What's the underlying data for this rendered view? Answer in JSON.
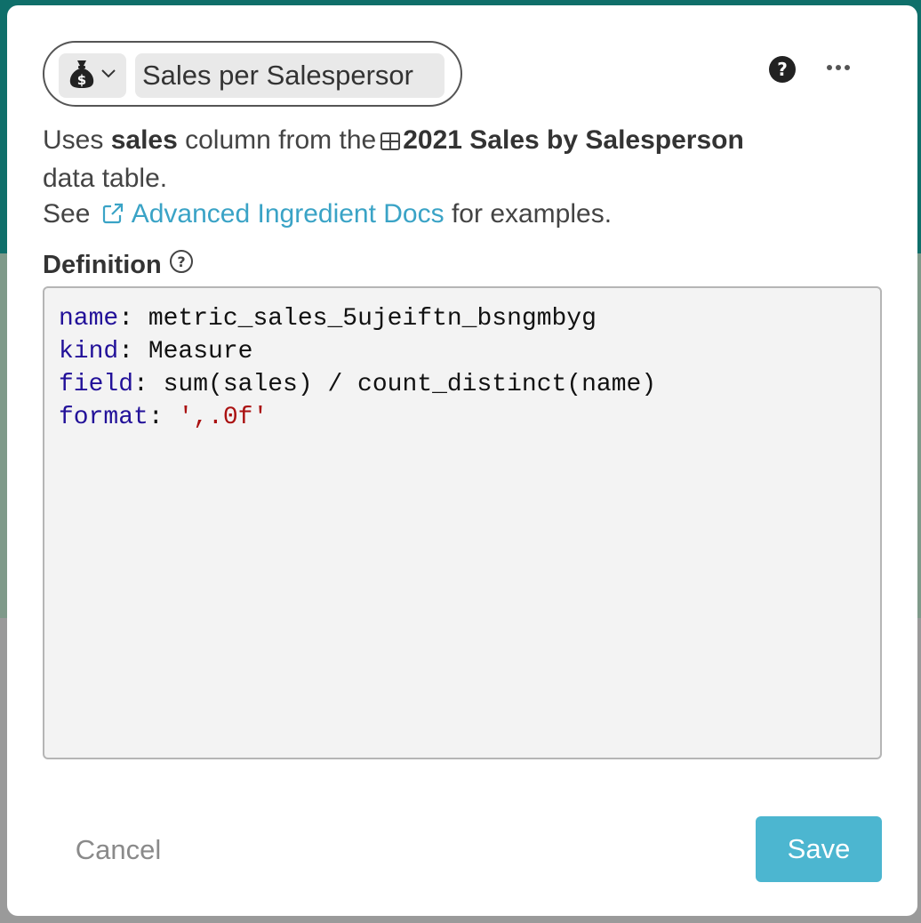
{
  "header": {
    "icon": "money-bag-icon",
    "name_value": "Sales per Salespersor"
  },
  "description": {
    "uses": "Uses",
    "column": "sales",
    "from_the": "column from the",
    "table_name": "2021 Sales by Salesperson",
    "data_table": "data table.",
    "see": "See",
    "link_text": "Advanced Ingredient Docs",
    "for_examples": "for examples."
  },
  "definition": {
    "label": "Definition",
    "lines": [
      {
        "key": "name",
        "sep": ": ",
        "value": "metric_sales_5ujeiftn_bsngmbyg",
        "is_string": false
      },
      {
        "key": "kind",
        "sep": ": ",
        "value": "Measure",
        "is_string": false
      },
      {
        "key": "field",
        "sep": ": ",
        "value": "sum(sales) / count_distinct(name)",
        "is_string": false
      },
      {
        "key": "format",
        "sep": ": ",
        "value": "',.0f'",
        "is_string": true
      }
    ]
  },
  "actions": {
    "cancel_label": "Cancel",
    "save_label": "Save"
  },
  "colors": {
    "accent": "#4cb6d0",
    "link": "#3aa3c6",
    "yaml_key": "#221199",
    "yaml_string": "#aa1111"
  }
}
